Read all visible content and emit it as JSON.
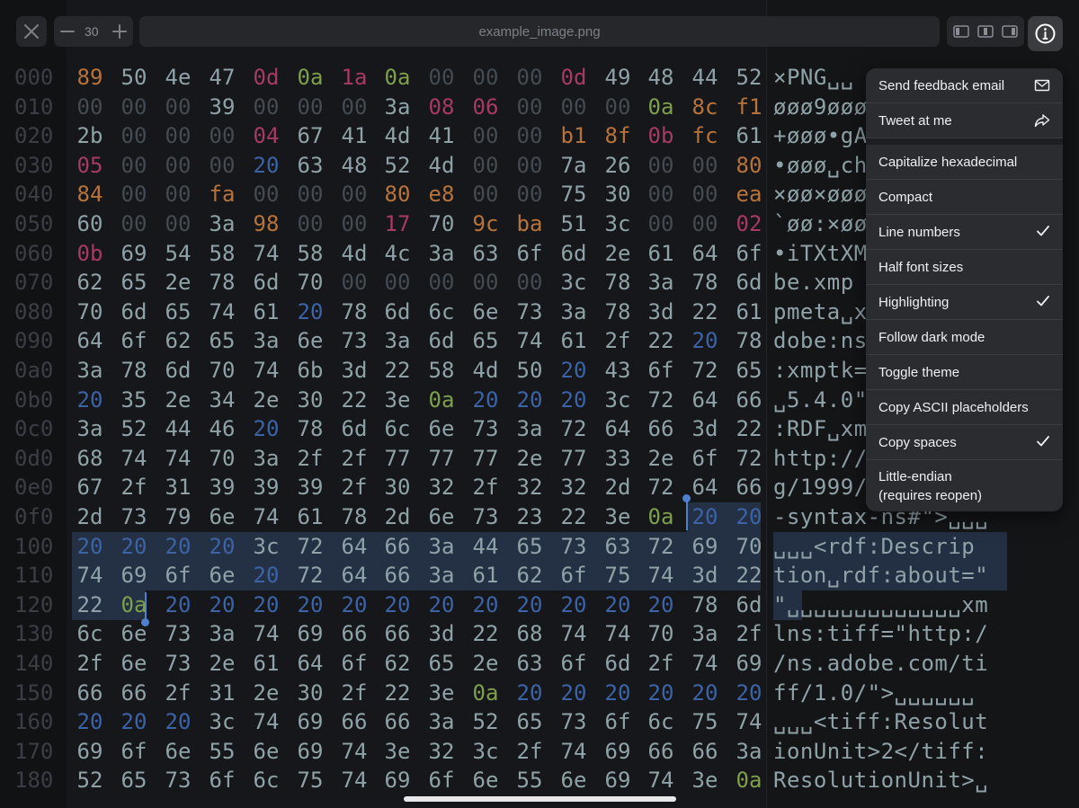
{
  "toolbar": {
    "file_title": "example_image.png",
    "zoom_value": "30",
    "icons": [
      "close-icon",
      "minus-icon",
      "plus-icon",
      "layout-left-icon",
      "layout-center-icon",
      "layout-right-icon",
      "info-icon"
    ]
  },
  "menu": {
    "items": [
      {
        "label": "Send feedback email",
        "icon": "envelope-icon"
      },
      {
        "label": "Tweet at me",
        "icon": "share-arrow-icon"
      },
      {
        "label": "Capitalize hexadecimal"
      },
      {
        "label": "Compact"
      },
      {
        "label": "Line numbers",
        "checked": true
      },
      {
        "label": "Half font sizes"
      },
      {
        "label": "Highlighting",
        "checked": true
      },
      {
        "label": "Follow dark mode"
      },
      {
        "label": "Toggle theme"
      },
      {
        "label": "Copy ASCII placeholders"
      },
      {
        "label": "Copy spaces",
        "checked": true
      },
      {
        "label": "Little-endian",
        "sublabel": "(requires reopen)"
      }
    ]
  },
  "hex": {
    "rows": [
      {
        "offset": "000",
        "bytes": [
          "89",
          "50",
          "4e",
          "47",
          "0d",
          "0a",
          "1a",
          "0a",
          "00",
          "00",
          "00",
          "0d",
          "49",
          "48",
          "44",
          "52"
        ],
        "ascii": "×PNG␣␣"
      },
      {
        "offset": "010",
        "bytes": [
          "00",
          "00",
          "00",
          "39",
          "00",
          "00",
          "00",
          "3a",
          "08",
          "06",
          "00",
          "00",
          "00",
          "0a",
          "8c",
          "f1"
        ],
        "ascii": "øøø9øøø"
      },
      {
        "offset": "020",
        "bytes": [
          "2b",
          "00",
          "00",
          "00",
          "04",
          "67",
          "41",
          "4d",
          "41",
          "00",
          "00",
          "b1",
          "8f",
          "0b",
          "fc",
          "61"
        ],
        "ascii": "+øøø•gA"
      },
      {
        "offset": "030",
        "bytes": [
          "05",
          "00",
          "00",
          "00",
          "20",
          "63",
          "48",
          "52",
          "4d",
          "00",
          "00",
          "7a",
          "26",
          "00",
          "00",
          "80"
        ],
        "ascii": "•øøø␣ch"
      },
      {
        "offset": "040",
        "bytes": [
          "84",
          "00",
          "00",
          "fa",
          "00",
          "00",
          "00",
          "80",
          "e8",
          "00",
          "00",
          "75",
          "30",
          "00",
          "00",
          "ea"
        ],
        "ascii": "×øø×øøø"
      },
      {
        "offset": "050",
        "bytes": [
          "60",
          "00",
          "00",
          "3a",
          "98",
          "00",
          "00",
          "17",
          "70",
          "9c",
          "ba",
          "51",
          "3c",
          "00",
          "00",
          "02"
        ],
        "ascii": "`øø:×øø"
      },
      {
        "offset": "060",
        "bytes": [
          "0b",
          "69",
          "54",
          "58",
          "74",
          "58",
          "4d",
          "4c",
          "3a",
          "63",
          "6f",
          "6d",
          "2e",
          "61",
          "64",
          "6f"
        ],
        "ascii": "•iTXtXM"
      },
      {
        "offset": "070",
        "bytes": [
          "62",
          "65",
          "2e",
          "78",
          "6d",
          "70",
          "00",
          "00",
          "00",
          "00",
          "00",
          "3c",
          "78",
          "3a",
          "78",
          "6d"
        ],
        "ascii": "be.xmp"
      },
      {
        "offset": "080",
        "bytes": [
          "70",
          "6d",
          "65",
          "74",
          "61",
          "20",
          "78",
          "6d",
          "6c",
          "6e",
          "73",
          "3a",
          "78",
          "3d",
          "22",
          "61"
        ],
        "ascii": "pmeta␣x"
      },
      {
        "offset": "090",
        "bytes": [
          "64",
          "6f",
          "62",
          "65",
          "3a",
          "6e",
          "73",
          "3a",
          "6d",
          "65",
          "74",
          "61",
          "2f",
          "22",
          "20",
          "78"
        ],
        "ascii": "dobe:ns"
      },
      {
        "offset": "0a0",
        "bytes": [
          "3a",
          "78",
          "6d",
          "70",
          "74",
          "6b",
          "3d",
          "22",
          "58",
          "4d",
          "50",
          "20",
          "43",
          "6f",
          "72",
          "65"
        ],
        "ascii": ":xmptk="
      },
      {
        "offset": "0b0",
        "bytes": [
          "20",
          "35",
          "2e",
          "34",
          "2e",
          "30",
          "22",
          "3e",
          "0a",
          "20",
          "20",
          "20",
          "3c",
          "72",
          "64",
          "66"
        ],
        "ascii": "␣5.4.0\""
      },
      {
        "offset": "0c0",
        "bytes": [
          "3a",
          "52",
          "44",
          "46",
          "20",
          "78",
          "6d",
          "6c",
          "6e",
          "73",
          "3a",
          "72",
          "64",
          "66",
          "3d",
          "22"
        ],
        "ascii": ":RDF␣xm"
      },
      {
        "offset": "0d0",
        "bytes": [
          "68",
          "74",
          "74",
          "70",
          "3a",
          "2f",
          "2f",
          "77",
          "77",
          "77",
          "2e",
          "77",
          "33",
          "2e",
          "6f",
          "72"
        ],
        "ascii": "http://"
      },
      {
        "offset": "0e0",
        "bytes": [
          "67",
          "2f",
          "31",
          "39",
          "39",
          "39",
          "2f",
          "30",
          "32",
          "2f",
          "32",
          "32",
          "2d",
          "72",
          "64",
          "66"
        ],
        "ascii": "g/1999/"
      },
      {
        "offset": "0f0",
        "bytes": [
          "2d",
          "73",
          "79",
          "6e",
          "74",
          "61",
          "78",
          "2d",
          "6e",
          "73",
          "23",
          "22",
          "3e",
          "0a",
          "20",
          "20"
        ],
        "ascii": "-syntax-ns#\">␣␣␣"
      },
      {
        "offset": "100",
        "bytes": [
          "20",
          "20",
          "20",
          "20",
          "3c",
          "72",
          "64",
          "66",
          "3a",
          "44",
          "65",
          "73",
          "63",
          "72",
          "69",
          "70"
        ],
        "ascii": "␣␣␣<rdf:Descrip"
      },
      {
        "offset": "110",
        "bytes": [
          "74",
          "69",
          "6f",
          "6e",
          "20",
          "72",
          "64",
          "66",
          "3a",
          "61",
          "62",
          "6f",
          "75",
          "74",
          "3d",
          "22"
        ],
        "ascii": "tion␣rdf:about=\""
      },
      {
        "offset": "120",
        "bytes": [
          "22",
          "0a",
          "20",
          "20",
          "20",
          "20",
          "20",
          "20",
          "20",
          "20",
          "20",
          "20",
          "20",
          "20",
          "78",
          "6d"
        ],
        "ascii": "\"␣␣␣␣␣␣␣␣␣␣␣␣␣xm"
      },
      {
        "offset": "130",
        "bytes": [
          "6c",
          "6e",
          "73",
          "3a",
          "74",
          "69",
          "66",
          "66",
          "3d",
          "22",
          "68",
          "74",
          "74",
          "70",
          "3a",
          "2f"
        ],
        "ascii": "lns:tiff=\"http:/"
      },
      {
        "offset": "140",
        "bytes": [
          "2f",
          "6e",
          "73",
          "2e",
          "61",
          "64",
          "6f",
          "62",
          "65",
          "2e",
          "63",
          "6f",
          "6d",
          "2f",
          "74",
          "69"
        ],
        "ascii": "/ns.adobe.com/ti"
      },
      {
        "offset": "150",
        "bytes": [
          "66",
          "66",
          "2f",
          "31",
          "2e",
          "30",
          "2f",
          "22",
          "3e",
          "0a",
          "20",
          "20",
          "20",
          "20",
          "20",
          "20"
        ],
        "ascii": "ff/1.0/\">␣␣␣␣␣␣"
      },
      {
        "offset": "160",
        "bytes": [
          "20",
          "20",
          "20",
          "3c",
          "74",
          "69",
          "66",
          "66",
          "3a",
          "52",
          "65",
          "73",
          "6f",
          "6c",
          "75",
          "74"
        ],
        "ascii": "␣␣␣<tiff:Resolut"
      },
      {
        "offset": "170",
        "bytes": [
          "69",
          "6f",
          "6e",
          "55",
          "6e",
          "69",
          "74",
          "3e",
          "32",
          "3c",
          "2f",
          "74",
          "69",
          "66",
          "66",
          "3a"
        ],
        "ascii": "ionUnit>2</tiff:"
      },
      {
        "offset": "180",
        "bytes": [
          "52",
          "65",
          "73",
          "6f",
          "6c",
          "75",
          "74",
          "69",
          "6f",
          "6e",
          "55",
          "6e",
          "69",
          "74",
          "3e",
          "0a"
        ],
        "ascii": "ResolutionUnit>␣"
      }
    ]
  }
}
